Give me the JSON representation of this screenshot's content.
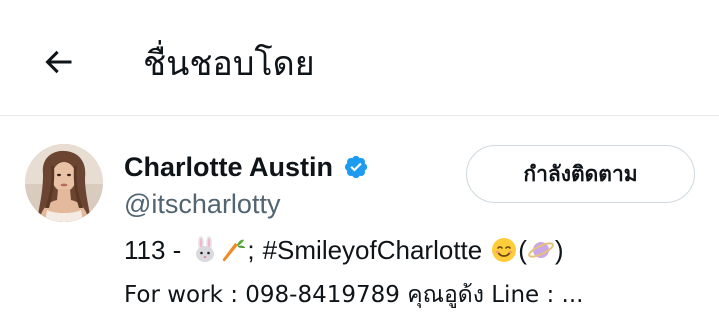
{
  "header": {
    "title": "ชื่นชอบโดย"
  },
  "user": {
    "display_name": "Charlotte Austin",
    "handle": "@itscharlotty",
    "follow_label": "กำลังติดตาม",
    "bio_line1_prefix": "113 -",
    "bio_line1_sep": ";",
    "bio_line1_hashtag": "#SmileyofCharlotte",
    "bio_line1_paren_open": "(",
    "bio_line1_paren_close": ")",
    "bio_line2": "For work : 098-8419789 คุณอูด้ง Line : ..."
  },
  "icons": {
    "back": "arrow-left-icon",
    "verified": "verified-badge-icon",
    "rabbit": "rabbit-emoji",
    "carrot": "carrot-emoji",
    "smile": "smiling-face-emoji",
    "planet": "ringed-planet-emoji"
  },
  "colors": {
    "verified_blue": "#1d9bf0",
    "text_primary": "#0f1419",
    "text_secondary": "#536471",
    "divider": "#e6e9eb",
    "button_border": "#cfd9de"
  }
}
